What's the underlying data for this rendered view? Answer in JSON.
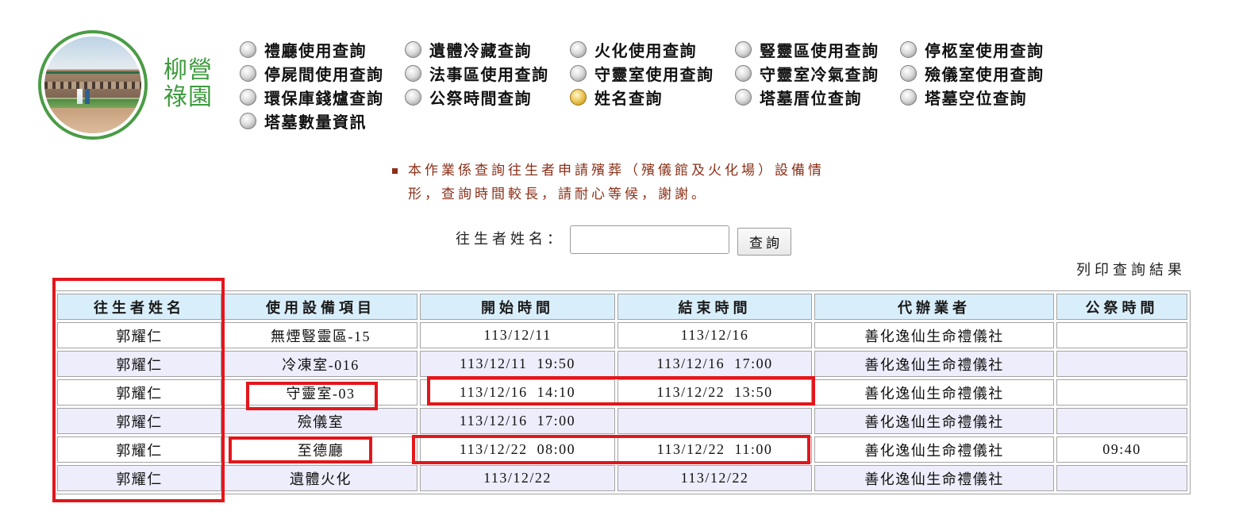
{
  "logo": {
    "icon": "building-photo-logo-icon"
  },
  "brand": {
    "line1": "柳營",
    "line2": "祿園"
  },
  "icons": {
    "nav_item": "radio-circle-icon",
    "notice_bullet": "square-bullet-icon"
  },
  "nav": {
    "items": [
      {
        "label": "禮廳使用查詢",
        "selected": false
      },
      {
        "label": "遺體冷藏查詢",
        "selected": false
      },
      {
        "label": "火化使用查詢",
        "selected": false
      },
      {
        "label": "豎靈區使用查詢",
        "selected": false
      },
      {
        "label": "停柩室使用查詢",
        "selected": false
      },
      {
        "label": "停屍間使用查詢",
        "selected": false
      },
      {
        "label": "法事區使用查詢",
        "selected": false
      },
      {
        "label": "守靈室使用查詢",
        "selected": false
      },
      {
        "label": "守靈室冷氣查詢",
        "selected": false
      },
      {
        "label": "殮儀室使用查詢",
        "selected": false
      },
      {
        "label": "環保庫錢爐查詢",
        "selected": false
      },
      {
        "label": "公祭時間查詢",
        "selected": false
      },
      {
        "label": "姓名查詢",
        "selected": true
      },
      {
        "label": "塔墓厝位查詢",
        "selected": false
      },
      {
        "label": "塔墓空位查詢",
        "selected": false
      },
      {
        "label": "塔墓數量資訊",
        "selected": false
      }
    ]
  },
  "notice": {
    "lines": [
      "本作業係查詢往生者申請殯葬（殯儀館及火化場）設備情",
      "形，查詢時間較長，請耐心等候，謝謝。"
    ]
  },
  "search": {
    "label": "往生者姓名：",
    "value": "",
    "button_label": "查詢"
  },
  "print_link": "列印查詢結果",
  "table": {
    "headers": [
      "往生者姓名",
      "使用設備項目",
      "開始時間",
      "結束時間",
      "代辦業者",
      "公祭時間"
    ],
    "rows": [
      [
        "郭耀仁",
        "無煙豎靈區-15",
        "113/12/11",
        "113/12/16",
        "善化逸仙生命禮儀社",
        ""
      ],
      [
        "郭耀仁",
        "冷凍室-016",
        "113/12/11  19:50",
        "113/12/16  17:00",
        "善化逸仙生命禮儀社",
        ""
      ],
      [
        "郭耀仁",
        "守靈室-03",
        "113/12/16  14:10",
        "113/12/22  13:50",
        "善化逸仙生命禮儀社",
        ""
      ],
      [
        "郭耀仁",
        "殮儀室",
        "113/12/16  17:00",
        "",
        "善化逸仙生命禮儀社",
        ""
      ],
      [
        "郭耀仁",
        "至德廳",
        "113/12/22  08:00",
        "113/12/22  11:00",
        "善化逸仙生命禮儀社",
        "09:40"
      ],
      [
        "郭耀仁",
        "遺體火化",
        "113/12/22",
        "113/12/22",
        "善化逸仙生命禮儀社",
        ""
      ]
    ]
  },
  "colors": {
    "brand_green": "#3d9a3d",
    "logo_ring": "#4a9c44",
    "notice_text": "#8b3018",
    "header_bg": "#d9eefb",
    "alt_row_bg": "#ededfc",
    "annotation_red": "#e3161b",
    "nav_selected": "#d9a628"
  }
}
